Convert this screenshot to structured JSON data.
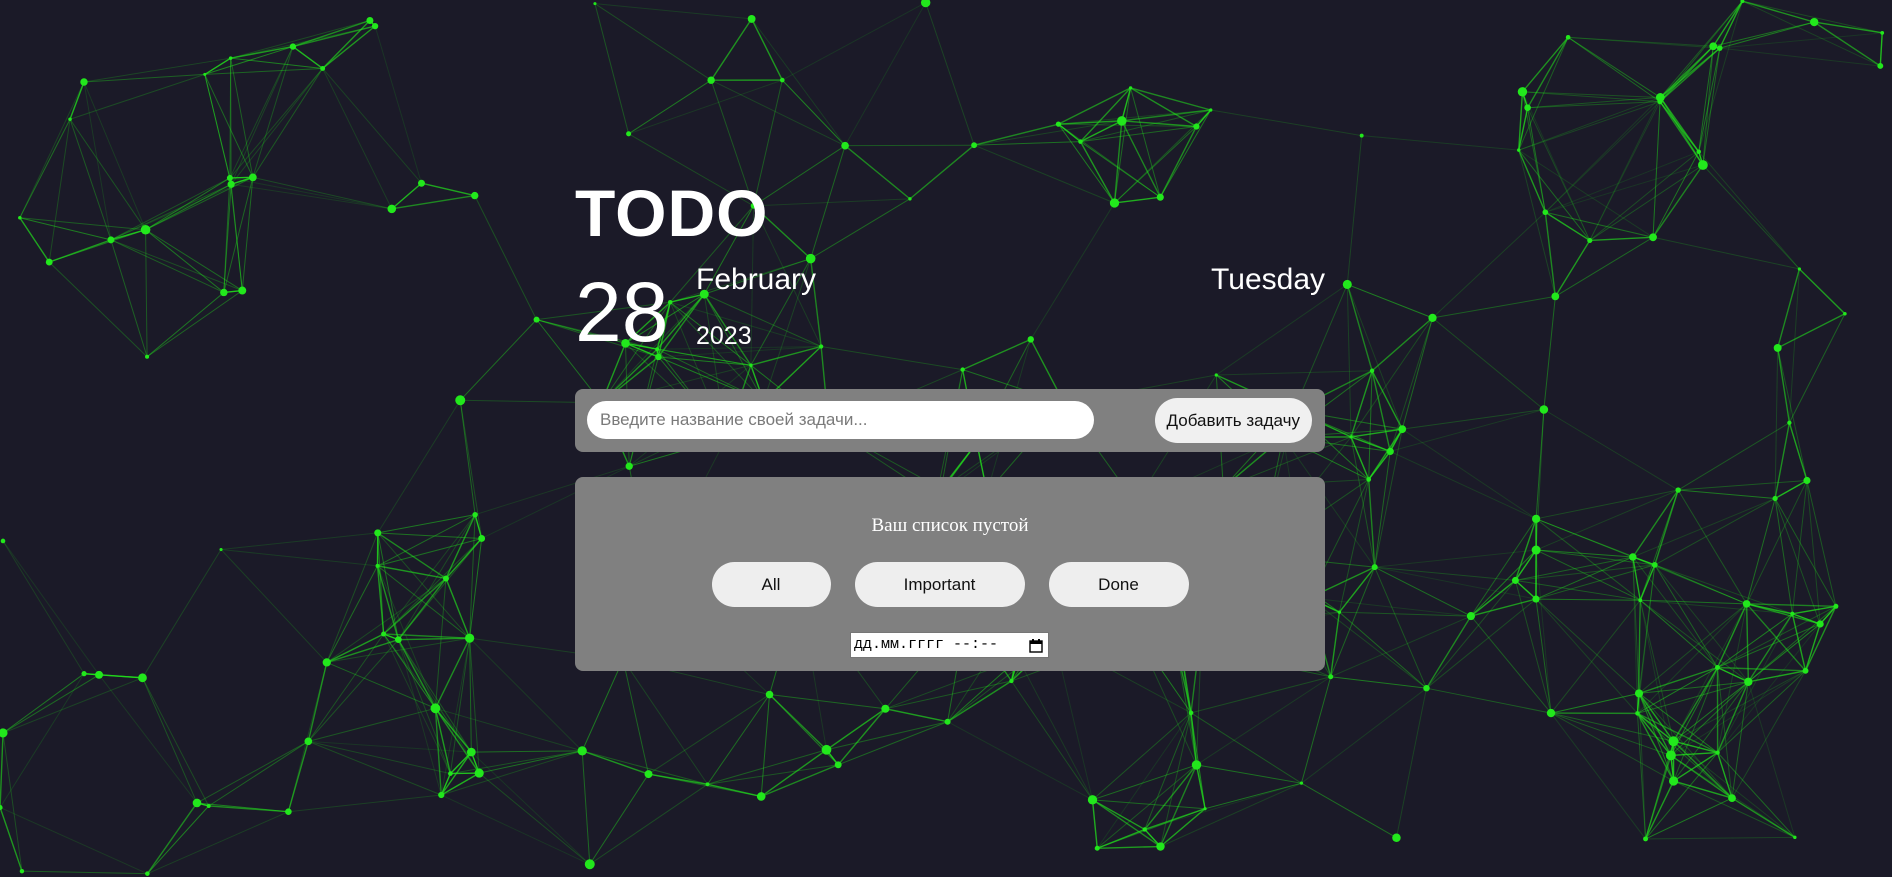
{
  "header": {
    "title": "TODO",
    "day": "28",
    "month": "February",
    "year": "2023",
    "weekday": "Tuesday"
  },
  "add_task": {
    "placeholder": "Введите название своей задачи...",
    "value": "",
    "button_label": "Добавить задачу"
  },
  "list": {
    "empty_message": "Ваш список пустой",
    "filters": [
      {
        "label": "All"
      },
      {
        "label": "Important"
      },
      {
        "label": "Done"
      }
    ],
    "datetime_placeholder": "дд.мм.гггг --:--"
  },
  "colors": {
    "background": "#1b1a28",
    "panel": "#808080",
    "accent_network": "#22e81c",
    "text": "#ffffff"
  },
  "icons": {
    "calendar": "calendar-icon"
  }
}
